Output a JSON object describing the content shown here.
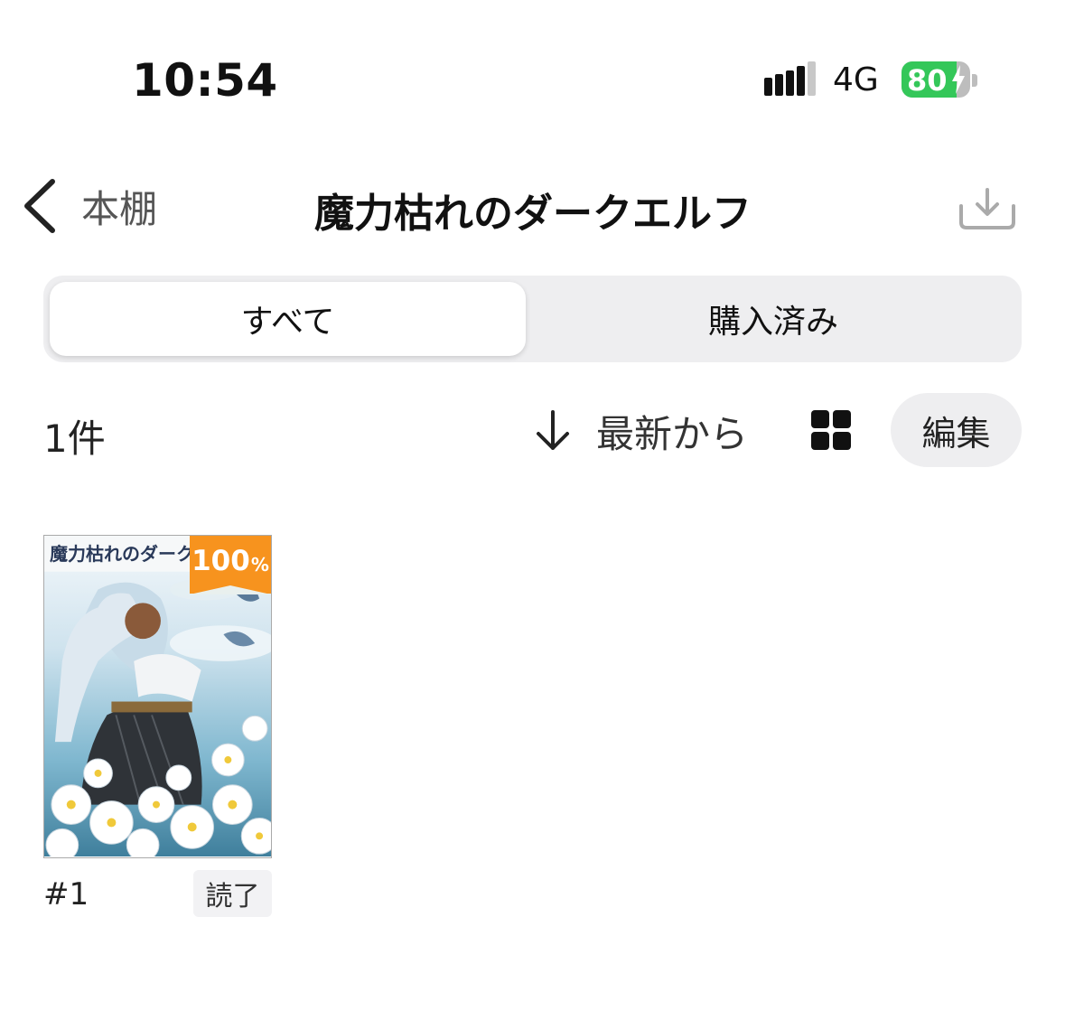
{
  "status_bar": {
    "time": "10:54",
    "network": "4G",
    "battery": "80",
    "battery_level": 0.8,
    "icons": [
      "signal-icon",
      "battery-charging-icon"
    ]
  },
  "nav": {
    "back_label": "本棚",
    "title": "魔力枯れのダークエルフ",
    "icons": [
      "chevron-left-icon",
      "download-icon"
    ]
  },
  "segments": {
    "all_label": "すべて",
    "purchased_label": "購入済み",
    "selected": "すべて"
  },
  "toolbar": {
    "count": "1件",
    "sort_label": "最新から",
    "edit_label": "編集",
    "icons": [
      "arrow-down-icon",
      "grid-view-icon"
    ]
  },
  "books": [
    {
      "cover_title": "魔力枯れのダークエ",
      "progress_value": "100",
      "progress_unit": "%",
      "progress": 1.0,
      "number": "#1",
      "status": "読了"
    }
  ],
  "colors": {
    "accent_orange": "#f7931e",
    "battery_green": "#34c759",
    "segment_bg": "#eeeef0"
  }
}
